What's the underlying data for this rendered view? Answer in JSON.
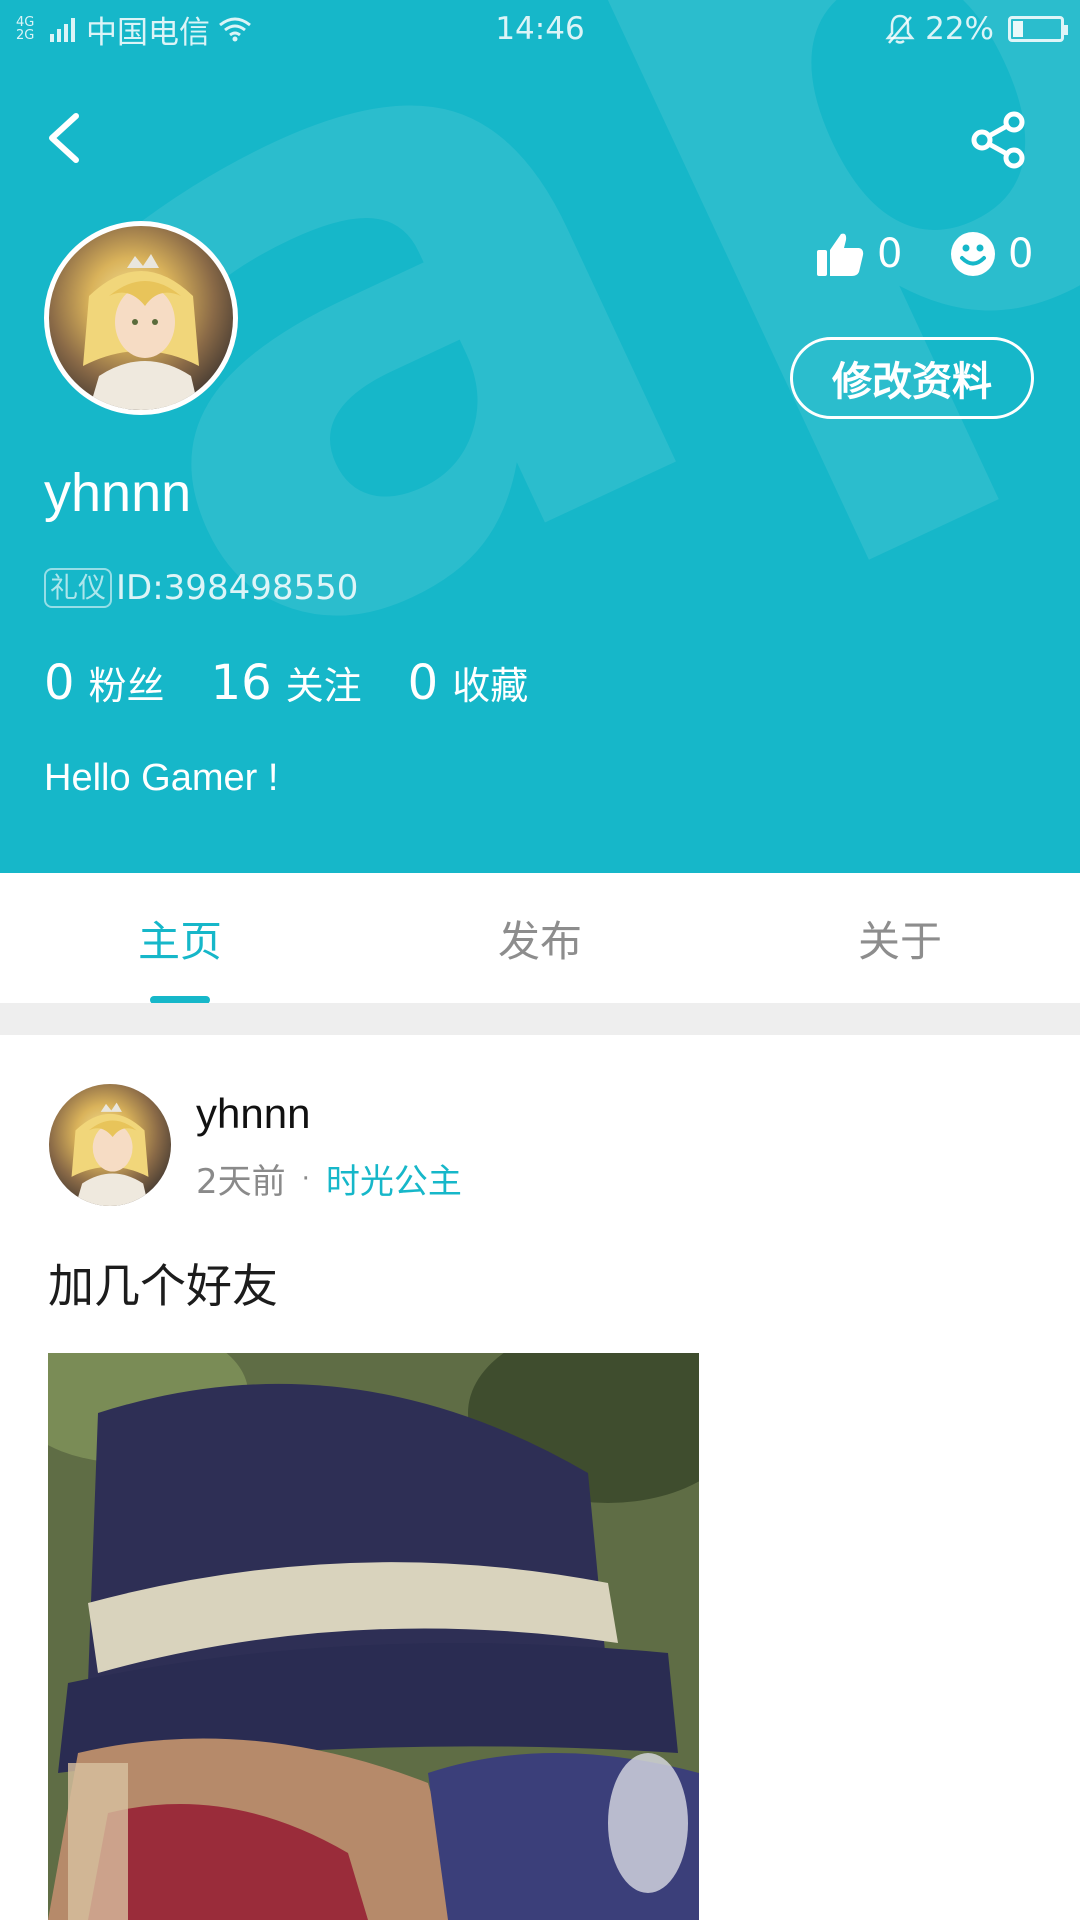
{
  "status_bar": {
    "network": "4G 2G",
    "carrier": "中国电信",
    "time": "14:46",
    "battery": "22%",
    "battery_level": 0.22
  },
  "header": {
    "watermark": "aptap",
    "username": "yhnnn",
    "badge": "礼仪",
    "id_text": "ID:398498550",
    "likes": "0",
    "smiles": "0",
    "edit_button": "修改资料",
    "counts": [
      {
        "value": "0",
        "label": "粉丝"
      },
      {
        "value": "16",
        "label": "关注"
      },
      {
        "value": "0",
        "label": "收藏"
      }
    ],
    "bio": "Hello Gamer !"
  },
  "tabs": [
    {
      "label": "主页",
      "active": true
    },
    {
      "label": "发布",
      "active": false
    },
    {
      "label": "关于",
      "active": false
    }
  ],
  "post": {
    "username": "yhnnn",
    "time": "2天前",
    "separator": "·",
    "game": "时光公主",
    "text": "加几个好友"
  },
  "colors": {
    "accent": "#16b7c9",
    "tab_inactive": "#8d8d8d",
    "divider": "#eeeeee"
  }
}
